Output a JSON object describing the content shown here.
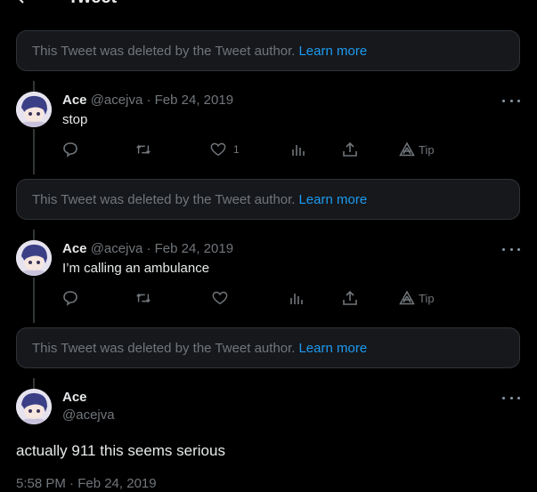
{
  "header": {
    "title": "Tweet"
  },
  "deleted_notice": {
    "text": "This Tweet was deleted by the Tweet author.",
    "link": "Learn more"
  },
  "replies": [
    {
      "name": "Ace",
      "handle": "@acejva",
      "sep": "·",
      "date": "Feb 24, 2019",
      "text": "stop",
      "like_count": "1",
      "tip_label": "Tip"
    },
    {
      "name": "Ace",
      "handle": "@acejva",
      "sep": "·",
      "date": "Feb 24, 2019",
      "text": "I’m calling an ambulance",
      "like_count": "",
      "tip_label": "Tip"
    }
  ],
  "main_tweet": {
    "name": "Ace",
    "handle": "@acejva",
    "text": "actually 911 this seems serious",
    "timestamp": "5:58 PM · Feb 24, 2019"
  },
  "icons": {
    "back": "arrow-left-icon",
    "more": "more-horizontal-icon",
    "reply": "reply-icon",
    "retweet": "retweet-icon",
    "like": "heart-icon",
    "views": "views-icon",
    "share": "share-icon",
    "tip": "tip-icon"
  },
  "colors": {
    "background": "#000000",
    "accent": "#1d9bf0",
    "muted": "#71767b",
    "text": "#e7e9ea",
    "border": "#2f3336"
  }
}
